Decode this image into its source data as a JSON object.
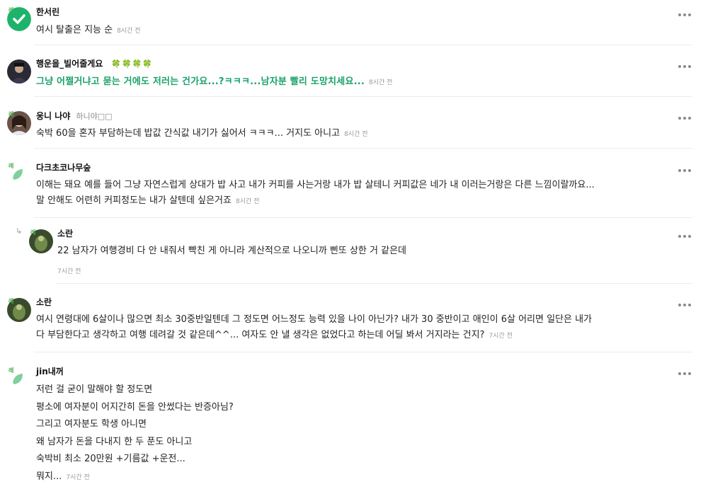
{
  "comments": [
    {
      "name": "한서린",
      "lines": [
        "여시 탈출은 지능 순"
      ],
      "time": "8시간 전"
    },
    {
      "name": "행운을_빌어줄게요",
      "clovers": "🍀🍀🍀🍀",
      "lines": [
        "그냥 어쩔거냐고 묻는 거에도 저러는 건가요...?ㅋㅋㅋ...남자분 빨리 도망치세요..."
      ],
      "time": "8시간 전"
    },
    {
      "name": "웅니 나야",
      "extra": "하니야□□",
      "lines": [
        "숙박 60을 혼자 부담하는데 밥값 간식값 내기가 싫어서 ㅋㅋㅋ... 거지도 아니고"
      ],
      "time": "8시간 전"
    },
    {
      "name": "다크초코나무숲",
      "lines": [
        "이해는 돼요 예를 들어 그냥 자연스럽게 상대가 밥 사고 내가 커피를 사는거랑 내가 밥 살테니 커피값은 네가 내 이러는거랑은 다른 느낌이랄까요...",
        "말 안해도 어련히 커피정도는 내가 살텐데 싶은거죠"
      ],
      "time": "8시간 전"
    },
    {
      "name": "소란",
      "lines": [
        "22 남자가 여행경비 다 안 내줘서 빡친 게 아니라 계산적으로 나오니까 삔또 상한 거 같은데"
      ],
      "time": "7시간 전"
    },
    {
      "name": "소란",
      "lines": [
        "여시 연령대에 6살이나 많으면 최소 30중반일텐데 그 정도면 어느정도 능력 있을 나이 아닌가? 내가 30 중반이고 애인이 6살 어리면 일단은 내가",
        "다 부담한다고 생각하고 여행 데려갈 것 같은데^^... 여자도 안 낼 생각은 없었다고 하는데 어딜 봐서 거지라는 건지?"
      ],
      "time": "7시간 전"
    },
    {
      "name": "jin내꺼",
      "lines": [
        "저런 걸 굳이 말해야 할 정도면",
        "평소에 여자분이 어지간히 돈을 안썼다는 반증아님?",
        "그리고 여자분도 학생 아니면",
        "왜 남자가 돈을 다내지 한 두 푼도 아니고",
        "숙박비 최소 20만원 +기름값 +운전...",
        "뭐지..."
      ],
      "time": "7시간 전"
    }
  ],
  "level_badge": "레",
  "reply_marker": "↳",
  "colors": {
    "accent_green": "#1aa36a",
    "time_gray": "#999999",
    "divider": "#ececec"
  }
}
